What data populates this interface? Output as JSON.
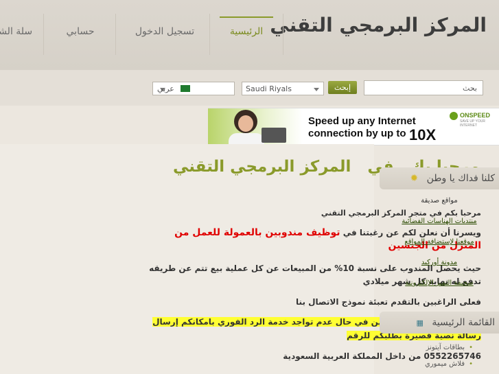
{
  "header": {
    "logo": "المركز البرمجي التقني",
    "nav": [
      {
        "label": "الرئيسية"
      },
      {
        "label": "تسجيل الدخول"
      },
      {
        "label": "حسابي"
      },
      {
        "label": "سلة الشراء"
      }
    ]
  },
  "toolbar": {
    "search_placeholder": "بحث",
    "search_button": "إبحث",
    "currency": "Saudi Riyals",
    "language": "عربي"
  },
  "banner": {
    "brand": "ONSPEED",
    "brand_tagline": "SAVE UP YOUR INTERNET",
    "line1": "Speed up any Internet",
    "line2": "connection by up to",
    "highlight": "10X"
  },
  "main": {
    "welcome_part1": "مرحبا بك",
    "welcome_part2": "في",
    "welcome_part3": "المركز البرمجي التقني",
    "p1": "مرحبا بكم في متجر المركز البرمجي التقني",
    "p2_intro": "ويسرنا أن نعلن لكم عن رغبتنا في",
    "p2_red1": "توظيف مندوبين بالعمولة للعمل من",
    "p2_red2": "المنزل من الجنسين",
    "p3_line1": "حيث يحصل المندوب على نسبة 10% من المبيعات عن كل عملية بيع تتم عن طريقه",
    "p3_line2": "تدفع له نهاية كل شهر ميلادي",
    "p4": "فعلى الراغبين بالتقدم تعبئة نموذج الاتصال بنا",
    "p5_line1": "وبالنسبة للأخوة المتسوقين في حال عدم تواجد خدمة الرد الفوري بامكانكم إرسال",
    "p5_line2": "رسالة نصية قصيرة بطلبكم للرقم",
    "p6": "0552265746 من داخل المملكة العربية السعودية"
  },
  "sidebar": {
    "box1_title": "كلنا فداك يا وطن",
    "box1_links": [
      "مواقع صديقة",
      "منتديات الهناسات الفضائية",
      "موقعنا لإستضافة المواقع",
      "مدونة أوركيد",
      "صحيفة التميز الإلكترونية"
    ],
    "box2_title": "القائمة الرئيسية",
    "box2_items": [
      "بطاقات آيتونز",
      "فلاش ميموري"
    ]
  }
}
